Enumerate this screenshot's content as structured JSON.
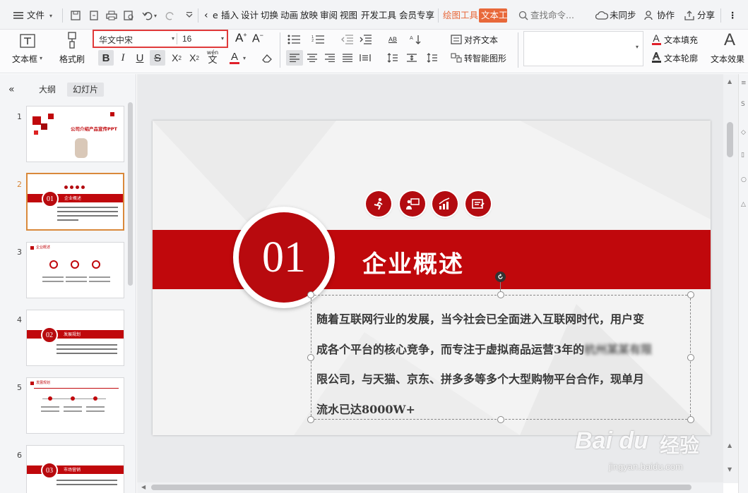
{
  "menubar": {
    "file_label": "文件",
    "tabs": [
      "插入",
      "设计",
      "切换",
      "动画",
      "放映",
      "审阅",
      "视图",
      "开发工具",
      "会员专享"
    ],
    "collapsed_tab": "e",
    "context_tab1": "绘图工具",
    "context_tab2": "文本工",
    "search_placeholder": "查找命令...",
    "sync_label": "未同步",
    "collab_label": "协作",
    "share_label": "分享"
  },
  "ribbon": {
    "textbox_label": "文本框",
    "format_painter_label": "格式刷",
    "font_name": "华文中宋",
    "font_size": "16",
    "align_text_label": "对齐文本",
    "smart_shape_label": "转智能图形",
    "text_fill_label": "文本填充",
    "text_outline_label": "文本轮廓",
    "text_effect_label": "文本效果",
    "pinyin_glyph": "wén",
    "ab_label": "AB"
  },
  "left_panel": {
    "tab_outline": "大纲",
    "tab_slides": "幻灯片",
    "slides": [
      {
        "num": "1",
        "title": "公司介绍产品宣传PPT"
      },
      {
        "num": "2",
        "badge": "01",
        "title": "企业概述"
      },
      {
        "num": "3",
        "title": "企业概述"
      },
      {
        "num": "4",
        "badge": "02",
        "title": "发展规划"
      },
      {
        "num": "5",
        "title": "发展规划"
      },
      {
        "num": "6",
        "badge": "03",
        "title": "市场营销"
      }
    ]
  },
  "slide": {
    "number": "01",
    "title": "企业概述",
    "body_lines": [
      "随着互联网行业的发展，当今社会已全面进入互联网时代，用户变",
      "成各个平台的核心竞争，而专注于虚拟商品运营3年的",
      "限公司，与天猫、京东、拼多多等多个大型购物平台合作，现单月",
      "流水已达8000W+"
    ],
    "blurred_text": "杭州某某有限",
    "icons": [
      "runner-icon",
      "presenter-icon",
      "growth-chart-icon",
      "document-icon"
    ]
  },
  "watermark": {
    "brand": "Bai du",
    "suffix": "经验",
    "url": "jingyan.baidu.com"
  },
  "colors": {
    "accent_red": "#c0080c",
    "highlight_border": "#e03a3a",
    "context_orange": "#e8683a"
  }
}
